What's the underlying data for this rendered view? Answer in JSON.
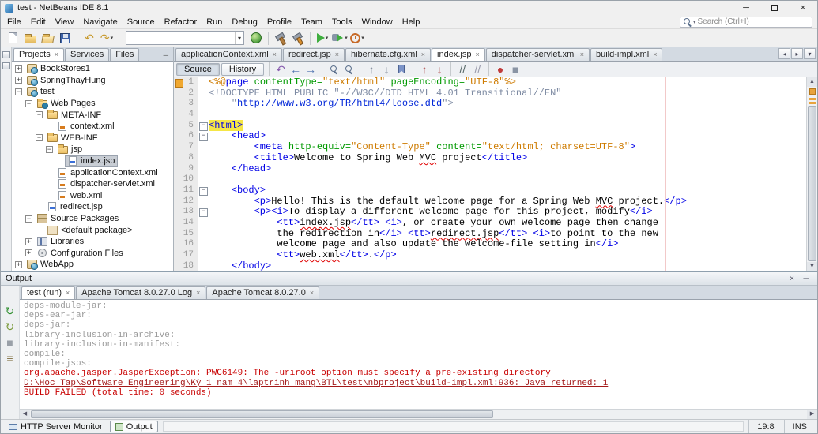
{
  "window": {
    "title": "test - NetBeans IDE 8.1",
    "controls": {
      "minimize": "─",
      "close": "×"
    }
  },
  "menubar": {
    "items": [
      "File",
      "Edit",
      "View",
      "Navigate",
      "Source",
      "Refactor",
      "Run",
      "Debug",
      "Profile",
      "Team",
      "Tools",
      "Window",
      "Help"
    ],
    "search_placeholder": "Search (Ctrl+I)"
  },
  "toolbar": {
    "items": [
      {
        "name": "new-file-button",
        "icon": "new-file-icon",
        "kind": "page"
      },
      {
        "name": "new-project-button",
        "icon": "new-project-icon",
        "kind": "folder"
      },
      {
        "name": "open-project-button",
        "icon": "open-project-icon",
        "kind": "folder-open"
      },
      {
        "name": "save-all-button",
        "icon": "save-all-icon",
        "kind": "floppy"
      },
      {
        "type": "sep"
      },
      {
        "name": "undo-button",
        "icon": "undo-icon",
        "glyph": "↶",
        "color": "#c79a2e"
      },
      {
        "name": "redo-button",
        "icon": "redo-icon",
        "glyph": "↷",
        "color": "#c79a2e",
        "dropdown": true
      },
      {
        "type": "sep"
      },
      {
        "name": "project-configuration-combo",
        "type": "combo",
        "value": ""
      },
      {
        "name": "ide-browser-button",
        "icon": "globe-icon",
        "kind": "globe"
      },
      {
        "type": "sep"
      },
      {
        "name": "build-project-button",
        "icon": "hammer-icon",
        "kind": "hammer"
      },
      {
        "name": "clean-build-project-button",
        "icon": "clean-build-icon",
        "kind": "clean"
      },
      {
        "type": "sep"
      },
      {
        "name": "run-project-button",
        "icon": "run-icon",
        "kind": "run",
        "dropdown": true
      },
      {
        "name": "debug-project-button",
        "icon": "debug-icon",
        "kind": "debug",
        "dropdown": true
      },
      {
        "name": "profile-project-button",
        "icon": "profile-icon",
        "kind": "profile",
        "dropdown": true
      }
    ]
  },
  "projects_panel": {
    "tabs": [
      {
        "label": "Projects",
        "active": true,
        "closable": true
      },
      {
        "label": "Services"
      },
      {
        "label": "Files"
      }
    ],
    "tree": [
      {
        "label": "BookStores1",
        "level": 0,
        "icon": "web-project",
        "handle": "collapsed"
      },
      {
        "label": "SpringThayHung",
        "level": 0,
        "icon": "web-project",
        "handle": "collapsed"
      },
      {
        "label": "test",
        "level": 0,
        "icon": "web-project",
        "handle": "expanded"
      },
      {
        "label": "Web Pages",
        "level": 1,
        "icon": "web-folder",
        "handle": "expanded"
      },
      {
        "label": "META-INF",
        "level": 2,
        "icon": "folder",
        "handle": "expanded"
      },
      {
        "label": "context.xml",
        "level": 3,
        "icon": "xml-file"
      },
      {
        "label": "WEB-INF",
        "level": 2,
        "icon": "folder",
        "handle": "expanded"
      },
      {
        "label": "jsp",
        "level": 3,
        "icon": "folder",
        "handle": "expanded"
      },
      {
        "label": "index.jsp",
        "level": 4,
        "icon": "jsp-file",
        "selected": true
      },
      {
        "label": "applicationContext.xml",
        "level": 3,
        "icon": "xml-file"
      },
      {
        "label": "dispatcher-servlet.xml",
        "level": 3,
        "icon": "xml-file"
      },
      {
        "label": "web.xml",
        "level": 3,
        "icon": "xml-file"
      },
      {
        "label": "redirect.jsp",
        "level": 2,
        "icon": "jsp-file"
      },
      {
        "label": "Source Packages",
        "level": 1,
        "icon": "packages",
        "handle": "expanded"
      },
      {
        "label": "<default package>",
        "level": 2,
        "icon": "package"
      },
      {
        "label": "Libraries",
        "level": 1,
        "icon": "libraries",
        "handle": "collapsed"
      },
      {
        "label": "Configuration Files",
        "level": 1,
        "icon": "config",
        "handle": "collapsed"
      },
      {
        "label": "WebApp",
        "level": 0,
        "icon": "web-project",
        "handle": "collapsed"
      }
    ]
  },
  "editor": {
    "tabs": [
      {
        "label": "applicationContext.xml",
        "closable": true
      },
      {
        "label": "redirect.jsp",
        "closable": true
      },
      {
        "label": "hibernate.cfg.xml",
        "closable": true
      },
      {
        "label": "index.jsp",
        "active": true,
        "closable": true
      },
      {
        "label": "dispatcher-servlet.xml",
        "closable": true
      },
      {
        "label": "build-impl.xml",
        "closable": true
      }
    ],
    "views": [
      {
        "label": "Source",
        "active": true
      },
      {
        "label": "History"
      }
    ],
    "toolbar_items": [
      {
        "name": "last-edit-button",
        "icon": "last-edit-icon",
        "glyph": "↶",
        "color": "#8a5fb0"
      },
      {
        "name": "back-button",
        "icon": "back-icon",
        "glyph": "←",
        "color": "#4a6fae"
      },
      {
        "name": "forward-button",
        "icon": "forward-icon",
        "glyph": "→",
        "color": "#4a6fae"
      },
      {
        "type": "sep"
      },
      {
        "name": "find-selection-button",
        "icon": "search-icon",
        "kind": "mag"
      },
      {
        "name": "incremental-search-button",
        "icon": "search-highlight-icon",
        "kind": "mag"
      },
      {
        "type": "sep"
      },
      {
        "name": "previous-bookmark-button",
        "icon": "previous-bookmark-icon",
        "glyph": "↑",
        "color": "#7a8494"
      },
      {
        "name": "next-bookmark-button",
        "icon": "next-bookmark-icon",
        "glyph": "↓",
        "color": "#7a8494"
      },
      {
        "name": "toggle-bookmark-button",
        "icon": "bookmark-icon",
        "kind": "bookmark"
      },
      {
        "type": "sep"
      },
      {
        "name": "previous-error-button",
        "icon": "previous-error-icon",
        "glyph": "↑",
        "color": "#b05050"
      },
      {
        "name": "next-error-button",
        "icon": "next-error-icon",
        "glyph": "↓",
        "color": "#b05050"
      },
      {
        "type": "sep"
      },
      {
        "name": "comment-button",
        "icon": "comment-icon",
        "glyph": "//",
        "color": "#566"
      },
      {
        "name": "uncomment-button",
        "icon": "uncomment-icon",
        "glyph": "//",
        "color": "#99a"
      },
      {
        "type": "sep"
      },
      {
        "name": "start-macro-button",
        "icon": "record-macro-icon",
        "glyph": "●",
        "color": "#c03a3a"
      },
      {
        "name": "stop-macro-button",
        "icon": "stop-macro-icon",
        "glyph": "■",
        "color": "#8a94a4"
      }
    ],
    "lines": [
      {
        "n": 1,
        "ann": true,
        "toks": [
          {
            "c": "jspd",
            "t": "<%@"
          },
          {
            "c": "tag",
            "t": "page"
          },
          {
            "c": "txt",
            "t": " "
          },
          {
            "c": "attr",
            "t": "contentType"
          },
          {
            "c": "eq",
            "t": "="
          },
          {
            "c": "val",
            "t": "\"text/html\""
          },
          {
            "c": "txt",
            "t": " "
          },
          {
            "c": "attr",
            "t": "pageEncoding"
          },
          {
            "c": "eq",
            "t": "="
          },
          {
            "c": "val",
            "t": "\"UTF-8\""
          },
          {
            "c": "jspd",
            "t": "%>"
          }
        ]
      },
      {
        "n": 2,
        "toks": [
          {
            "c": "doct",
            "t": "<!DOCTYPE HTML PUBLIC \"-//W3C//DTD HTML 4.01 Transitional//EN\""
          }
        ]
      },
      {
        "n": 3,
        "toks": [
          {
            "c": "doct",
            "t": "    \""
          },
          {
            "c": "link",
            "t": "http://www.w3.org/TR/html4/loose.dtd"
          },
          {
            "c": "doct",
            "t": "\">"
          }
        ]
      },
      {
        "n": 4,
        "toks": []
      },
      {
        "n": 5,
        "fold": true,
        "toks": [
          {
            "c": "tag hl",
            "t": "<html>"
          }
        ]
      },
      {
        "n": 6,
        "fold": true,
        "toks": [
          {
            "c": "txt",
            "t": "    "
          },
          {
            "c": "tag",
            "t": "<head>"
          }
        ]
      },
      {
        "n": 7,
        "toks": [
          {
            "c": "txt",
            "t": "        "
          },
          {
            "c": "tag",
            "t": "<meta"
          },
          {
            "c": "txt",
            "t": " "
          },
          {
            "c": "attr",
            "t": "http-equiv"
          },
          {
            "c": "eq",
            "t": "="
          },
          {
            "c": "val",
            "t": "\"Content-Type\""
          },
          {
            "c": "txt",
            "t": " "
          },
          {
            "c": "attr",
            "t": "content"
          },
          {
            "c": "eq",
            "t": "="
          },
          {
            "c": "val",
            "t": "\"text/html; charset=UTF-8\""
          },
          {
            "c": "tag",
            "t": ">"
          }
        ]
      },
      {
        "n": 8,
        "toks": [
          {
            "c": "txt",
            "t": "        "
          },
          {
            "c": "tag",
            "t": "<title>"
          },
          {
            "c": "txt",
            "t": "Welcome to Spring Web "
          },
          {
            "c": "txt sp",
            "t": "MVC"
          },
          {
            "c": "txt",
            "t": " project"
          },
          {
            "c": "tag",
            "t": "</title>"
          }
        ]
      },
      {
        "n": 9,
        "toks": [
          {
            "c": "txt",
            "t": "    "
          },
          {
            "c": "tag",
            "t": "</head>"
          }
        ]
      },
      {
        "n": 10,
        "toks": []
      },
      {
        "n": 11,
        "fold": true,
        "toks": [
          {
            "c": "txt",
            "t": "    "
          },
          {
            "c": "tag",
            "t": "<body>"
          }
        ]
      },
      {
        "n": 12,
        "toks": [
          {
            "c": "txt",
            "t": "        "
          },
          {
            "c": "tag",
            "t": "<p>"
          },
          {
            "c": "txt",
            "t": "Hello! This is the default welcome page for a Spring Web "
          },
          {
            "c": "txt sp",
            "t": "MVC"
          },
          {
            "c": "txt",
            "t": " project."
          },
          {
            "c": "tag",
            "t": "</p>"
          }
        ]
      },
      {
        "n": 13,
        "fold": true,
        "toks": [
          {
            "c": "txt",
            "t": "        "
          },
          {
            "c": "tag",
            "t": "<p>"
          },
          {
            "c": "tag",
            "t": "<i>"
          },
          {
            "c": "txt",
            "t": "To display a different welcome page for this project, modify"
          },
          {
            "c": "tag",
            "t": "</i>"
          }
        ]
      },
      {
        "n": 14,
        "toks": [
          {
            "c": "txt",
            "t": "            "
          },
          {
            "c": "tag",
            "t": "<tt>"
          },
          {
            "c": "txt sp",
            "t": "index.jsp"
          },
          {
            "c": "tag",
            "t": "</tt>"
          },
          {
            "c": "txt",
            "t": " "
          },
          {
            "c": "tag",
            "t": "<i>"
          },
          {
            "c": "txt",
            "t": ", or create your own welcome page then change"
          }
        ]
      },
      {
        "n": 15,
        "toks": [
          {
            "c": "txt",
            "t": "            "
          },
          {
            "c": "txt",
            "t": "the redirection in"
          },
          {
            "c": "tag",
            "t": "</i>"
          },
          {
            "c": "txt",
            "t": " "
          },
          {
            "c": "tag",
            "t": "<tt>"
          },
          {
            "c": "txt sp",
            "t": "redirect.jsp"
          },
          {
            "c": "tag",
            "t": "</tt>"
          },
          {
            "c": "txt",
            "t": " "
          },
          {
            "c": "tag",
            "t": "<i>"
          },
          {
            "c": "txt",
            "t": "to point to the new"
          }
        ]
      },
      {
        "n": 16,
        "toks": [
          {
            "c": "txt",
            "t": "            "
          },
          {
            "c": "txt",
            "t": "welcome page and also update the welcome-file setting in"
          },
          {
            "c": "tag",
            "t": "</i>"
          }
        ]
      },
      {
        "n": 17,
        "toks": [
          {
            "c": "txt",
            "t": "            "
          },
          {
            "c": "tag",
            "t": "<tt>"
          },
          {
            "c": "txt sp",
            "t": "web.xml"
          },
          {
            "c": "tag",
            "t": "</tt>"
          },
          {
            "c": "txt",
            "t": "."
          },
          {
            "c": "tag",
            "t": "</p>"
          }
        ]
      },
      {
        "n": 18,
        "toks": [
          {
            "c": "txt",
            "t": "    "
          },
          {
            "c": "tag",
            "t": "</body>"
          }
        ]
      }
    ]
  },
  "output": {
    "title": "Output",
    "header_buttons": [
      {
        "name": "close-output-button",
        "icon": "close-icon",
        "glyph": "×"
      },
      {
        "name": "minimize-output-button",
        "icon": "minimize-icon",
        "glyph": "─"
      }
    ],
    "strip_buttons": [
      {
        "name": "rerun-button",
        "icon": "rerun-icon",
        "glyph": "↻",
        "color": "#2f8f2f"
      },
      {
        "name": "rerun-with-args-button",
        "icon": "rerun-args-icon",
        "glyph": "↻",
        "color": "#7a9a3a"
      },
      {
        "name": "stop-build-button",
        "icon": "stop-icon",
        "glyph": "■",
        "color": "#9aa0a8"
      },
      {
        "name": "ant-settings-button",
        "icon": "settings-icon",
        "glyph": "≡",
        "color": "#8a7a50"
      }
    ],
    "tabs": [
      {
        "label": "test (run)",
        "active": true,
        "closable": true
      },
      {
        "label": "Apache Tomcat 8.0.27.0 Log",
        "closable": true
      },
      {
        "label": "Apache Tomcat 8.0.27.0",
        "closable": true
      }
    ],
    "lines": [
      {
        "c": "target",
        "t": "deps-module-jar:"
      },
      {
        "c": "target",
        "t": "deps-ear-jar:"
      },
      {
        "c": "target",
        "t": "deps-jar:"
      },
      {
        "c": "target",
        "t": "library-inclusion-in-archive:"
      },
      {
        "c": "target",
        "t": "library-inclusion-in-manifest:"
      },
      {
        "c": "target",
        "t": "compile:"
      },
      {
        "c": "target",
        "t": "compile-jsps:"
      },
      {
        "c": "error",
        "t": "org.apache.jasper.JasperException: PWC6149: The -uriroot option must specify a pre-existing directory"
      },
      {
        "c": "link",
        "t": "D:\\Hoc Tap\\Software Engineering\\Kỳ 1 nam 4\\laptrinh mang\\BTL\\test\\nbproject\\build-impl.xml:936: Java returned: 1"
      },
      {
        "c": "error",
        "t": "BUILD FAILED (total time: 0 seconds)"
      }
    ]
  },
  "statusbar": {
    "windows": [
      {
        "label": "HTTP Server Monitor",
        "icon": "http-monitor-icon"
      },
      {
        "label": "Output",
        "icon": "output-window-icon",
        "active": true
      }
    ],
    "caret": "19:8",
    "mode": "INS"
  }
}
